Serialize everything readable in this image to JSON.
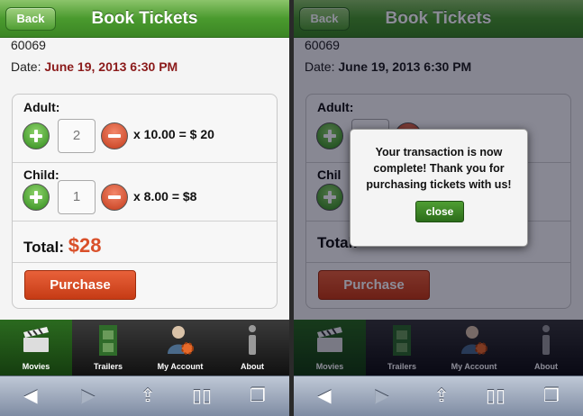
{
  "screens": [
    {
      "header": {
        "back_label": "Back",
        "title": "Book Tickets"
      },
      "order_number": "60069",
      "date_label": "Date:",
      "date_value": "June 19, 2013 6:30 PM",
      "adult": {
        "label": "Adult:",
        "quantity": "2",
        "calc": "x 10.00 = $ 20"
      },
      "child": {
        "label": "Child:",
        "quantity": "1",
        "calc": "x 8.00 = $8"
      },
      "total_label": "Total:",
      "total_value": "$28",
      "purchase_label": "Purchase"
    },
    {
      "header": {
        "back_label": "Back",
        "title": "Book Tickets"
      },
      "order_number": "60069",
      "date_label": "Date:",
      "date_value": "June 19, 2013 6:30 PM",
      "adult": {
        "label": "Adult:"
      },
      "child": {
        "label": "Chil"
      },
      "total_label": "Total:",
      "purchase_label": "Purchase",
      "dialog": {
        "message": "Your transaction is now complete! Thank you for purchasing tickets with us!",
        "close_label": "close"
      }
    }
  ],
  "tabs": [
    {
      "label": "Movies",
      "icon": "clapperboard-icon",
      "active": true
    },
    {
      "label": "Trailers",
      "icon": "film-strip-icon",
      "active": false
    },
    {
      "label": "My Account",
      "icon": "user-gear-icon",
      "active": false
    },
    {
      "label": "About",
      "icon": "info-icon",
      "active": false
    }
  ],
  "browser_toolbar": [
    "back-arrow-icon",
    "forward-arrow-icon",
    "share-icon",
    "bookmarks-icon",
    "tabs-icon"
  ],
  "colors": {
    "header_green": "#4a9a2e",
    "date_red": "#8b1a1a",
    "total_orange": "#d9502a",
    "purchase_orange": "#d94b24"
  }
}
